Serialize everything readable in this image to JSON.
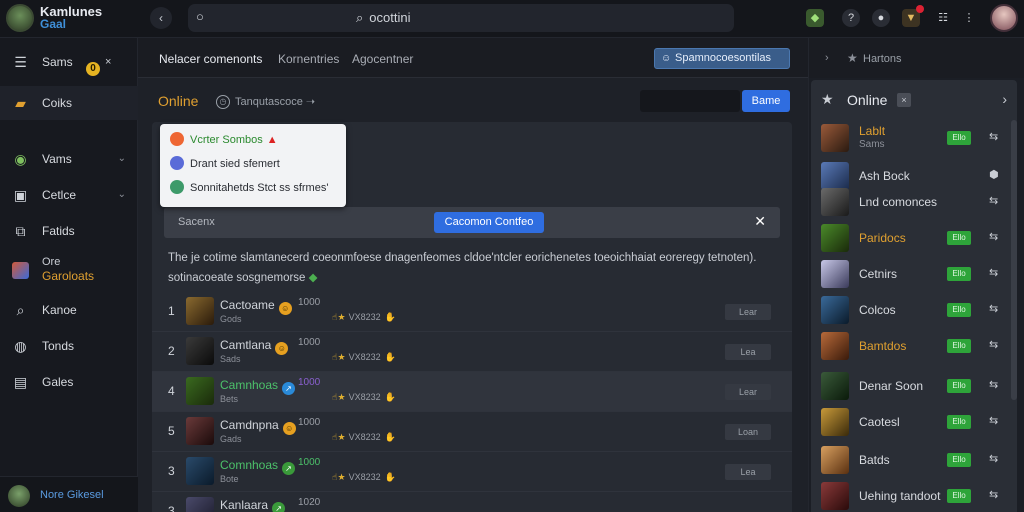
{
  "brand": {
    "title": "Kamlunes",
    "subtitle": "Gaal"
  },
  "search": {
    "value": "ocottini"
  },
  "sidebar": {
    "items": [
      {
        "label": "Sams",
        "icon": "menu-icon"
      },
      {
        "label": "Coiks",
        "icon": "folder-icon"
      },
      {
        "label": "Vams",
        "icon": "globe-icon"
      },
      {
        "label": "Cetlce",
        "icon": "box-icon"
      },
      {
        "label": "Fatids",
        "icon": "share-icon"
      },
      {
        "label_top": "Ore",
        "label_bottom": "Garoloats",
        "icon": "game-icon"
      },
      {
        "label": "Kanoe",
        "icon": "search-icon"
      },
      {
        "label": "Tonds",
        "icon": "chat-icon"
      },
      {
        "label": "Gales",
        "icon": "inbox-icon"
      }
    ],
    "coin_symbol": "0",
    "close_symbol": "×",
    "footer_name": "Nore Gikesel"
  },
  "main": {
    "tabs": [
      "Nelacer comenonts",
      "Kornentries",
      "Agocentner"
    ],
    "tab_button": "Spamnocoesontilas",
    "online": {
      "title": "Online",
      "subtitle": "Tanqutascoce ➝",
      "button": "Bame"
    },
    "popup": [
      "Vcrter Sombos",
      "Drant sied sfemert",
      "Sonnitahetds Stct ss sfrmes'"
    ],
    "filter": {
      "label": "Sacenx",
      "button": "Cacomon Contfeo"
    },
    "description": [
      "The je cotime slamtanecerd coeonmfoese dnagenfeomes cldoe'ntcler eorichenetes toeoichhaiat eoreregy tetnoten).",
      "sotinacoeate sosgnemorse"
    ],
    "rows": [
      {
        "rank": "1",
        "name": "Cactoame",
        "value": "1000",
        "status": "Gods",
        "code": "VX8232",
        "button": "Lear"
      },
      {
        "rank": "2",
        "name": "Camtlana",
        "value": "1000",
        "status": "Sads",
        "code": "VX8232",
        "button": "Lea"
      },
      {
        "rank": "4",
        "name": "Camnhoas",
        "value": "1000",
        "status": "Bets",
        "code": "VX8232",
        "button": "Lear"
      },
      {
        "rank": "5",
        "name": "Camdnpna",
        "value": "1000",
        "status": "Gads",
        "code": "VX8232",
        "button": "Loan"
      },
      {
        "rank": "3",
        "name": "Comnhoas",
        "value": "1000",
        "status": "Bote",
        "code": "VX8232",
        "button": "Lea"
      },
      {
        "rank": "3",
        "name": "Kanlaara",
        "value": "1020",
        "status": "",
        "code": "",
        "button": ""
      }
    ]
  },
  "rpanel": {
    "header": "Hartons",
    "title": "Online",
    "badge_x": "×",
    "badge": "Ello",
    "friends": [
      {
        "name": "Lablt",
        "sub": "Sams",
        "badge": true
      },
      {
        "name": "Ash Bock",
        "sub": "",
        "badge": false
      },
      {
        "name": "Lnd comonces",
        "sub": "",
        "badge": false
      },
      {
        "name": "Paridocs",
        "sub": "",
        "badge": true
      },
      {
        "name": "Cetnirs",
        "sub": "",
        "badge": true
      },
      {
        "name": "Colcos",
        "sub": "",
        "badge": true
      },
      {
        "name": "Bamtdos",
        "sub": "",
        "badge": true
      },
      {
        "name": "Denar Soon",
        "sub": "",
        "badge": true
      },
      {
        "name": "Caotesl",
        "sub": "",
        "badge": true
      },
      {
        "name": "Batds",
        "sub": "",
        "badge": true
      },
      {
        "name": "Uehing tandoot",
        "sub": "",
        "badge": true
      }
    ]
  },
  "colors": {
    "accent": "#2f6de0",
    "online": "#e0a030",
    "badge": "#2ea43a"
  }
}
